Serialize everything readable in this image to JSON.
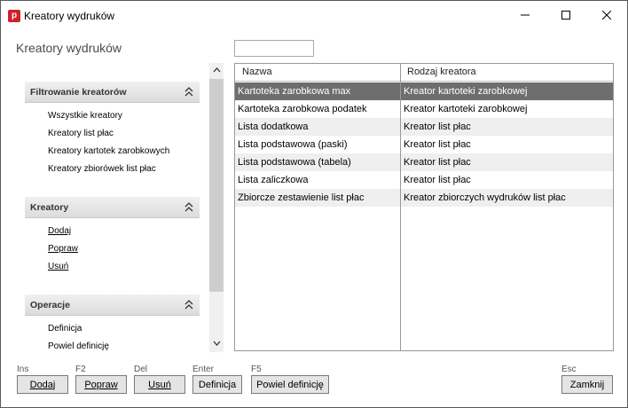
{
  "window": {
    "title": "Kreatory wydruków"
  },
  "page": {
    "heading": "Kreatory wydruków",
    "filter_placeholder": ""
  },
  "sections": [
    {
      "label": "Filtrowanie kreatorów",
      "items": [
        "Wszystkie kreatory",
        "Kreatory list płac",
        "Kreatory kartotek zarobkowych",
        "Kreatory zbiorówek list płac"
      ]
    },
    {
      "label": "Kreatory",
      "items": [
        "Dodaj",
        "Popraw",
        "Usuń"
      ]
    },
    {
      "label": "Operacje",
      "items": [
        "Definicja",
        "Powiel definicję"
      ]
    }
  ],
  "grid": {
    "columns": [
      "Nazwa",
      "Rodzaj kreatora"
    ],
    "rows": [
      {
        "name": "Kartoteka zarobkowa max",
        "type": "Kreator kartoteki zarobkowej"
      },
      {
        "name": "Kartoteka zarobkowa podatek",
        "type": "Kreator kartoteki zarobkowej"
      },
      {
        "name": "Lista dodatkowa",
        "type": "Kreator list płac"
      },
      {
        "name": "Lista podstawowa (paski)",
        "type": "Kreator list płac"
      },
      {
        "name": "Lista podstawowa (tabela)",
        "type": "Kreator list płac"
      },
      {
        "name": "Lista zaliczkowa",
        "type": "Kreator list płac"
      },
      {
        "name": "Zbiorcze zestawienie list płac",
        "type": "Kreator zbiorczych wydruków list płac"
      }
    ],
    "selected_index": 0
  },
  "toolbar": {
    "shortcuts": {
      "add": "Ins",
      "edit": "F2",
      "delete": "Del",
      "definition": "Enter",
      "duplicate": "F5",
      "close": "Esc"
    },
    "add_label": "Dodaj",
    "edit_label": "Popraw",
    "delete_label": "Usuń",
    "definition_label": "Definicja",
    "duplicate_label": "Powiel definicję",
    "close_label": "Zamknij"
  },
  "icons": {
    "app": "app-logo-icon",
    "minimize": "minimize-icon",
    "maximize": "maximize-icon",
    "close": "close-icon",
    "collapse": "double-chevron-up-icon",
    "scroll_up": "chevron-up-icon",
    "scroll_down": "chevron-down-icon"
  },
  "colors": {
    "accent": "#d0202a",
    "selection": "#6e6e6e",
    "row_alt": "#efefef"
  },
  "app_icon_letter": "p"
}
